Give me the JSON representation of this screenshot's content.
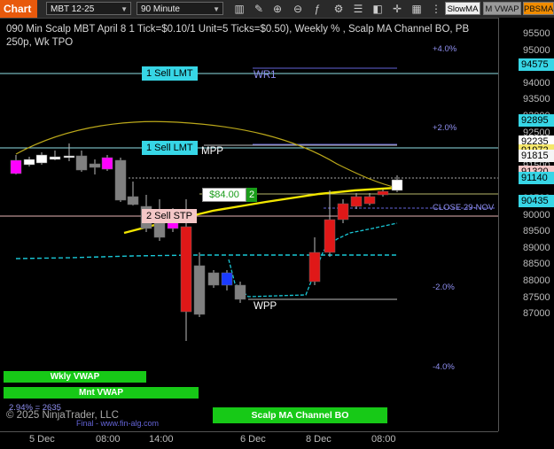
{
  "toolbar": {
    "chart_tab": "Chart",
    "instrument": "MBT 12-25",
    "timeframe": "90 Minute",
    "slow_ma": "SlowMA",
    "m_vwap": "M VWAP",
    "pbsma": "PBSMA"
  },
  "chart": {
    "title": "090 Min Scalp MBT April 8 1 Tick=$0.10/1 Unit=5 Ticks=$0.50), Weekly % , Scalp MA Channel BO, PB 250p, Wk TPO",
    "pct_labels": [
      "+4.0%",
      "+2.0%",
      "-2.0%",
      "-4.0%"
    ],
    "level_labels": {
      "wr1": "WR1",
      "mpp": "MPP",
      "wpp": "WPP",
      "close": "CLOSE 29-NOV"
    },
    "orders": [
      {
        "label": "1 Sell LMT",
        "price": "94575"
      },
      {
        "label": "1 Sell LMT",
        "price": "92895"
      },
      {
        "label": "2 Sell STP",
        "price": "91320"
      }
    ],
    "position": {
      "pnl": "$84.00",
      "qty": "2"
    },
    "indicator_bars": {
      "wkly_vwap": "Wkly VWAP",
      "mnt_vwap": "Mnt VWAP",
      "scalp_ma": "Scalp MA Channel BO"
    },
    "ratio_text": "2.94% = 2635",
    "copyright": "© 2025 NinjaTrader, LLC",
    "watermark": "Final - www.fin-alg.com",
    "close_icon": "x-icon"
  },
  "yaxis": {
    "ticks": [
      "95500",
      "95000",
      "94500",
      "94000",
      "93500",
      "93000",
      "92500",
      "92000",
      "91500",
      "91000",
      "90500",
      "90000",
      "89500",
      "89000",
      "88500",
      "88000",
      "87500",
      "87000"
    ],
    "tick_values": [
      95500,
      95000,
      94500,
      94000,
      93500,
      93000,
      92500,
      92000,
      91500,
      91000,
      90500,
      90000,
      89500,
      89000,
      88500,
      88000,
      87500,
      87000
    ],
    "flags": [
      {
        "value": "94575",
        "color": "#37d6e6"
      },
      {
        "value": "92895",
        "color": "#37d6e6"
      },
      {
        "value": "92235",
        "color": "#ffffff"
      },
      {
        "value": "91972",
        "color": "#f5e76a"
      },
      {
        "value": "91815",
        "color": "#f5f5f5"
      },
      {
        "value": "91320",
        "color": "#f4c7c7"
      },
      {
        "value": "91140",
        "color": "#37d6e6"
      },
      {
        "value": "90435",
        "color": "#37d6e6"
      }
    ]
  },
  "xaxis": {
    "labels": [
      "5 Dec",
      "08:00",
      "14:00",
      "6 Dec",
      "8 Dec",
      "08:00"
    ]
  },
  "colors": {
    "up_candle": "#ffffff",
    "down_candle": "#808080",
    "red_candle": "#e01818",
    "order_bg": "#37d6e6",
    "stop_bg": "#f4c7c7",
    "ma_yellow": "#f2e600",
    "vwap_cyan": "#19c7d6",
    "green_bar": "#17c917"
  }
}
